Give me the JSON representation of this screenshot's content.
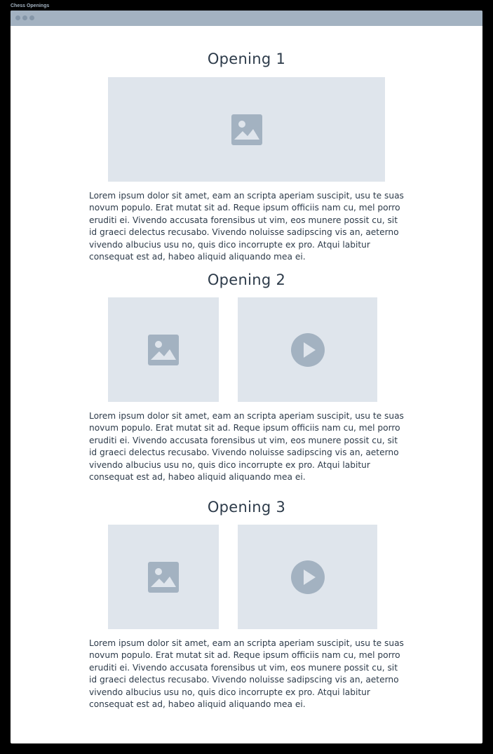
{
  "window": {
    "title": "Chess Openings"
  },
  "sections": [
    {
      "heading": "Opening 1",
      "body": "Lorem ipsum dolor sit amet, eam an scripta aperiam suscipit, usu te suas novum populo. Erat mutat sit ad. Reque ipsum officiis nam cu, mel porro eruditi ei. Vivendo accusata forensibus ut vim, eos munere possit cu, sit id graeci delectus recusabo. Vivendo noluisse sadipscing vis an, aeterno vivendo albucius usu no, quis dico incorrupte ex pro. Atqui labitur consequat est ad, habeo aliquid aliquando mea ei.",
      "media": [
        "image-icon"
      ]
    },
    {
      "heading": "Opening 2",
      "body": "Lorem ipsum dolor sit amet, eam an scripta aperiam suscipit, usu te suas novum populo. Erat mutat sit ad. Reque ipsum officiis nam cu, mel porro eruditi ei. Vivendo accusata forensibus ut vim, eos munere possit cu, sit id graeci delectus recusabo. Vivendo noluisse sadipscing vis an, aeterno vivendo albucius usu no, quis dico incorrupte ex pro. Atqui labitur consequat est ad, habeo aliquid aliquando mea ei.",
      "media": [
        "image-icon",
        "play-icon"
      ]
    },
    {
      "heading": "Opening 3",
      "body": "Lorem ipsum dolor sit amet, eam an scripta aperiam suscipit, usu te suas novum populo. Erat mutat sit ad. Reque ipsum officiis nam cu, mel porro eruditi ei. Vivendo accusata forensibus ut vim, eos munere possit cu, sit id graeci delectus recusabo. Vivendo noluisse sadipscing vis an, aeterno vivendo albucius usu no, quis dico incorrupte ex pro. Atqui labitur consequat est ad, habeo aliquid aliquando mea ei.",
      "media": [
        "image-icon",
        "play-icon"
      ]
    }
  ],
  "colors": {
    "background": "#000000",
    "window": "#ffffff",
    "titlebar": "#a3b2c1",
    "placeholder": "#dfe5ec",
    "icon": "#a3b2c1",
    "text": "#2d3b4a"
  }
}
